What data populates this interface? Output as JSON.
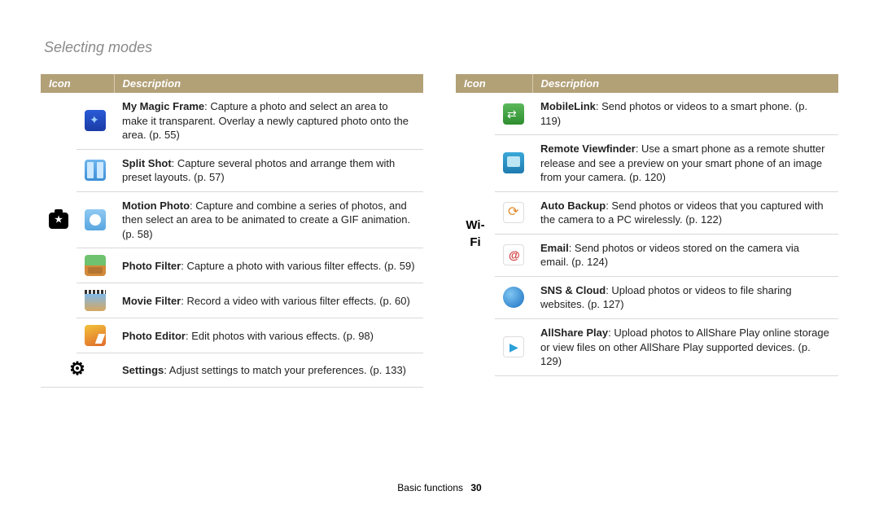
{
  "page_title": "Selecting modes",
  "footer_section": "Basic functions",
  "footer_page": "30",
  "headers": {
    "icon": "Icon",
    "description": "Description"
  },
  "left": {
    "category_label": "",
    "rows": [
      {
        "title": "My Magic Frame",
        "text": ": Capture a photo and select an area to make it transparent. Overlay a newly captured photo onto the area. (p. 55)"
      },
      {
        "title": "Split Shot",
        "text": ": Capture several photos and arrange them with preset layouts. (p. 57)"
      },
      {
        "title": "Motion Photo",
        "text": ": Capture and combine a series of photos, and then select an area to be animated to create a GIF animation. (p. 58)"
      },
      {
        "title": "Photo Filter",
        "text": ": Capture a photo with various filter effects. (p. 59)"
      },
      {
        "title": "Movie Filter",
        "text": ": Record a video with various filter effects. (p. 60)"
      },
      {
        "title": "Photo Editor",
        "text": ": Edit photos with various effects. (p. 98)"
      }
    ],
    "settings_row": {
      "title": "Settings",
      "text": ": Adjust settings to match your preferences. (p. 133)"
    }
  },
  "right": {
    "category_label": "Wi-Fi",
    "rows": [
      {
        "title": "MobileLink",
        "text": ": Send photos or videos to a smart phone. (p. 119)"
      },
      {
        "title": "Remote Viewfinder",
        "text": ": Use a smart phone as a remote shutter release and see a preview on your smart phone of an image from your camera. (p. 120)"
      },
      {
        "title": "Auto Backup",
        "text": ": Send photos or videos that you captured with the camera to a PC wirelessly. (p. 122)"
      },
      {
        "title": "Email",
        "text": ": Send photos or videos stored on the camera via email. (p. 124)"
      },
      {
        "title": "SNS & Cloud",
        "text": ": Upload photos or videos to file sharing websites. (p. 127)"
      },
      {
        "title": "AllShare Play",
        "text": ": Upload photos to AllShare Play online storage or view files on other AllShare Play supported devices. (p. 129)"
      }
    ]
  }
}
